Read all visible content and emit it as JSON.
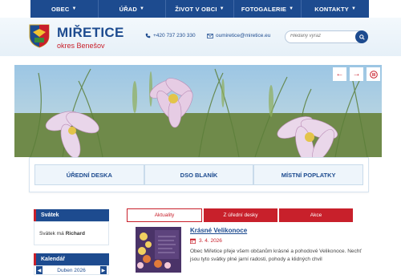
{
  "nav": {
    "items": [
      {
        "label": "OBEC",
        "caret": "▼"
      },
      {
        "label": "ÚŘAD",
        "caret": "▼"
      },
      {
        "label": "ŽIVOT V OBCI",
        "caret": "▼"
      },
      {
        "label": "FOTOGALERIE",
        "caret": "▼"
      },
      {
        "label": "KONTAKTY",
        "caret": "▼"
      }
    ]
  },
  "header": {
    "title": "MIŘETICE",
    "subtitle": "okres Benešov",
    "phone": "+420 737 230 330",
    "email": "oumiretice@miretice.eu",
    "search_placeholder": "Hledaný výraz"
  },
  "hero": {
    "prev_icon": "arrow-left-icon",
    "next_icon": "arrow-right-icon",
    "pause_icon": "pause-icon",
    "prev_glyph": "←",
    "next_glyph": "→"
  },
  "quick_links": [
    "ÚŘEDNÍ DESKA",
    "DSO BLANÍK",
    "MÍSTNÍ POPLATKY"
  ],
  "sidebar": {
    "holiday_heading": "Svátek",
    "holiday_prefix": "Svátek má",
    "holiday_name": "Richard",
    "calendar_heading": "Kalendář",
    "calendar_month": "Duben 2026",
    "calendar_prev": "◀",
    "calendar_next": "▶"
  },
  "tabs": [
    {
      "label": "Aktuality",
      "active": true
    },
    {
      "label": "Z úřední desky",
      "active": false
    },
    {
      "label": "Akce",
      "active": false
    }
  ],
  "article": {
    "title": "Krásné Velikonoce",
    "date": "3. 4. 2026",
    "text": "Obec Miřetice přeje všem občanům krásné a pohodové Velikonoce. Nechť jsou tyto svátky plné jarní radosti, pohody a klidných chvil"
  },
  "colors": {
    "brand_blue": "#1d4b8f",
    "accent_red": "#c8202b",
    "header_bg": "#eaf2f9"
  }
}
